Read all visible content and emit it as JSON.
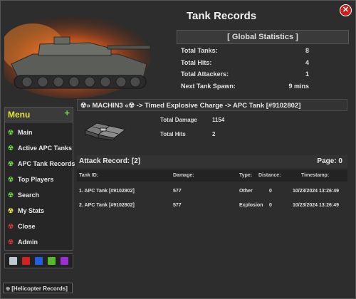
{
  "window": {
    "title": "Tank Records",
    "close_glyph": "✕"
  },
  "global_stats": {
    "header": "[ Global Statistics ]",
    "rows": [
      {
        "label": "Total Tanks:",
        "value": "8"
      },
      {
        "label": "Total Hits:",
        "value": "4"
      },
      {
        "label": "Total Attackers:",
        "value": "1"
      },
      {
        "label": "Next Tank Spawn:",
        "value": "9 mins"
      }
    ]
  },
  "menu": {
    "title": "Menu",
    "plus": "+",
    "items": [
      {
        "label": "Main",
        "icon": "radiation-icon",
        "color": "#6fd64a"
      },
      {
        "label": "Active APC Tanks",
        "icon": "radiation-icon",
        "color": "#6fd64a"
      },
      {
        "label": "APC Tank Records",
        "icon": "radiation-icon",
        "color": "#6fd64a"
      },
      {
        "label": "Top Players",
        "icon": "radiation-icon",
        "color": "#6fd64a"
      },
      {
        "label": "Search",
        "icon": "radiation-icon",
        "color": "#6fd64a"
      },
      {
        "label": "My Stats",
        "icon": "radiation-icon",
        "color": "#e4e43a"
      },
      {
        "label": "Close",
        "icon": "radiation-icon",
        "color": "#d83a3a"
      },
      {
        "label": "Admin",
        "icon": "radiation-icon",
        "color": "#d83a3a"
      }
    ],
    "swatches": [
      "#bfc7d0",
      "#d32020",
      "#1f5fe0",
      "#58b82a",
      "#9b2fd6"
    ]
  },
  "helicopter_records": {
    "label": "[Helicopter Records]"
  },
  "record": {
    "header": "☢» MACHIN3 «☢ -> Timed Explosive Charge  -> APC Tank [#9102802]",
    "total_damage_label": "Total Damage",
    "total_damage": "1154",
    "total_hits_label": "Total Hits",
    "total_hits": "2"
  },
  "attack": {
    "label": "Attack Record: [2]",
    "page": "Page: 0",
    "columns": [
      "Tank ID:",
      "Damage:",
      "Type:",
      "Distance:",
      "Timestamp:"
    ],
    "rows": [
      {
        "tank_id": "1. APC Tank [#9102802]",
        "damage": "577",
        "type": "Other",
        "distance": "0",
        "timestamp": "10/23/2024 13:26:49"
      },
      {
        "tank_id": "2. APC Tank [#9102802]",
        "damage": "577",
        "type": "Explosion",
        "distance": "0",
        "timestamp": "10/23/2024 13:26:49"
      }
    ]
  }
}
